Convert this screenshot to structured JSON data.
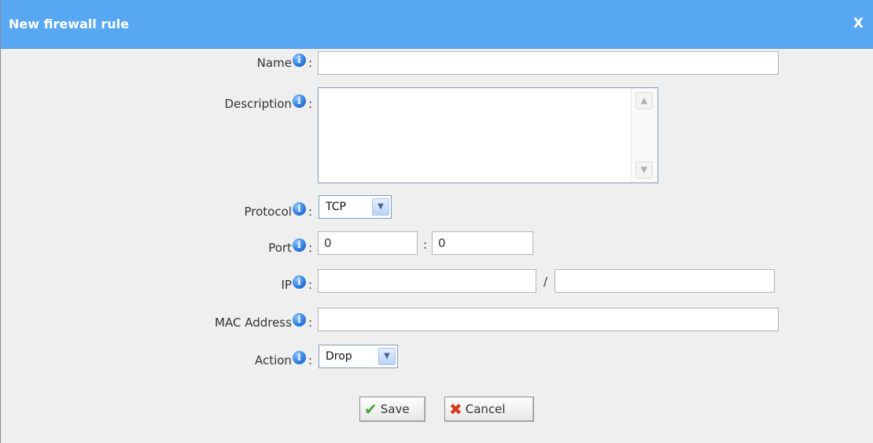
{
  "dialog": {
    "title": "New firewall rule",
    "close_label": "X"
  },
  "form": {
    "name": {
      "label": "Name",
      "value": ""
    },
    "description": {
      "label": "Description",
      "value": ""
    },
    "protocol": {
      "label": "Protocol",
      "selected": "TCP"
    },
    "port": {
      "label": "Port",
      "start": "0",
      "separator": ":",
      "end": "0"
    },
    "ip": {
      "label": "IP",
      "address": "",
      "separator": "/",
      "mask": ""
    },
    "mac": {
      "label": "MAC Address",
      "value": ""
    },
    "action": {
      "label": "Action",
      "selected": "Drop"
    },
    "colon": ":",
    "info_icon_glyph": "i"
  },
  "buttons": {
    "save_label": "Save",
    "cancel_label": "Cancel"
  },
  "icons": {
    "info": "info-icon",
    "check": "check-icon",
    "cancel": "x-icon",
    "dropdown": "chevron-down-icon"
  },
  "colors": {
    "titlebar": "#57a7f2",
    "background": "#efefef",
    "save_check": "#3fa12f",
    "cancel_x": "#d83a1c"
  }
}
